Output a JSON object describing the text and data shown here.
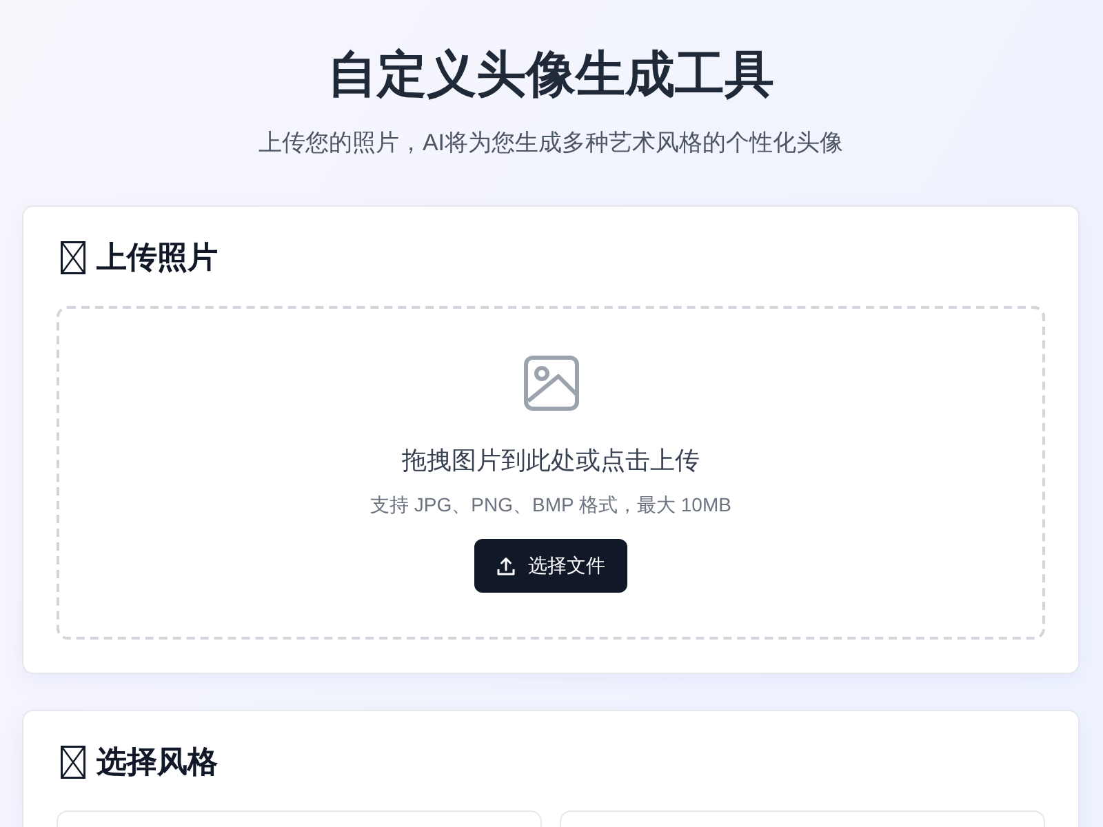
{
  "header": {
    "title": "自定义头像生成工具",
    "subtitle": "上传您的照片，AI将为您生成多种艺术风格的个性化头像"
  },
  "upload_section": {
    "heading": "上传照片",
    "dropzone": {
      "prompt": "拖拽图片到此处或点击上传",
      "hint": "支持 JPG、PNG、BMP 格式，最大 10MB"
    },
    "button": "选择文件"
  },
  "style_section": {
    "heading": "选择风格"
  }
}
